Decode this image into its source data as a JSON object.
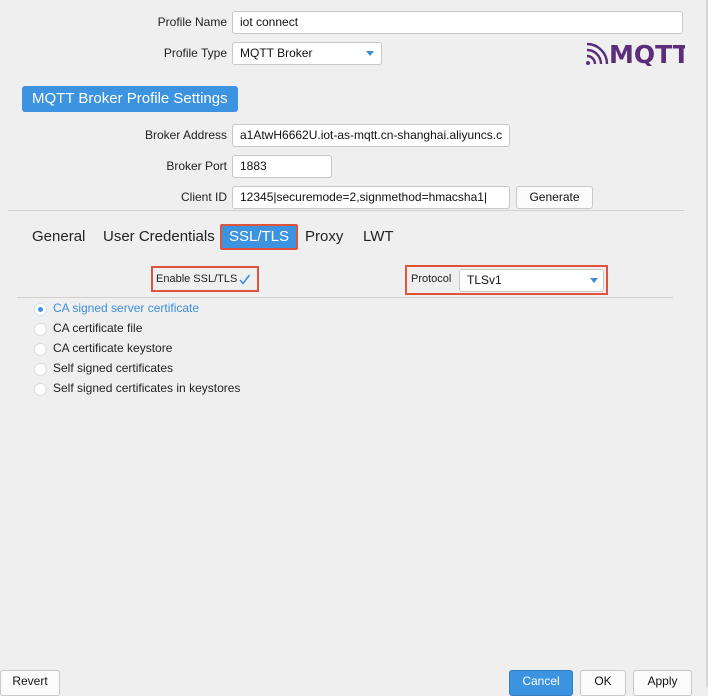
{
  "profile": {
    "name_label": "Profile Name",
    "name_value": "iot connect",
    "type_label": "Profile Type",
    "type_value": "MQTT Broker"
  },
  "section_title": "MQTT Broker Profile Settings",
  "broker": {
    "address_label": "Broker Address",
    "address_value": "a1AtwH6662U.iot-as-mqtt.cn-shanghai.aliyuncs.c",
    "port_label": "Broker Port",
    "port_value": "1883",
    "client_id_label": "Client ID",
    "client_id_value": "12345|securemode=2,signmethod=hmacsha1|",
    "generate_label": "Generate"
  },
  "tabs": [
    {
      "label": "General"
    },
    {
      "label": "User Credentials"
    },
    {
      "label": "SSL/TLS",
      "active": true
    },
    {
      "label": "Proxy"
    },
    {
      "label": "LWT"
    }
  ],
  "ssl": {
    "enable_label": "Enable SSL/TLS",
    "enabled": true,
    "protocol_label": "Protocol",
    "protocol_value": "TLSv1"
  },
  "cert_options": [
    {
      "label": "CA signed server certificate",
      "selected": true
    },
    {
      "label": "CA certificate file",
      "selected": false
    },
    {
      "label": "CA certificate keystore",
      "selected": false
    },
    {
      "label": "Self signed certificates",
      "selected": false
    },
    {
      "label": "Self signed certificates in keystores",
      "selected": false
    }
  ],
  "buttons": {
    "revert": "Revert",
    "cancel": "Cancel",
    "ok": "OK",
    "apply": "Apply"
  },
  "logo": {
    "text": "MQTT",
    "color": "#5c2d7a"
  },
  "colors": {
    "accent": "#3c93df",
    "highlight_box": "#e0533d"
  }
}
